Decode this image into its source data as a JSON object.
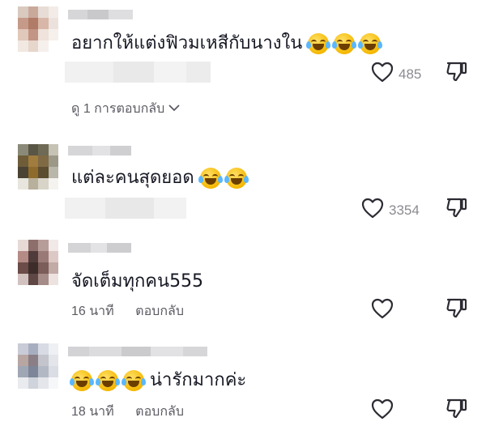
{
  "comments": [
    {
      "text": "อยากให้แต่งฟิวมเหสีกับนางใน",
      "emoji_count": 3,
      "like_count": "485",
      "view_replies": "ดู 1 การตอบกลับ"
    },
    {
      "text": "แต่ละคนสุดยอด",
      "emoji_count": 2,
      "like_count": "3354"
    },
    {
      "text": "จัดเต็มทุกคน555",
      "emoji_count": 0,
      "time": "16 นาที",
      "reply_label": "ตอบกลับ"
    },
    {
      "text": "น่ารักมากค่ะ",
      "emoji_count": 3,
      "emoji_first": true,
      "time": "18 นาที",
      "reply_label": "ตอบกลับ"
    }
  ],
  "icons": [
    "heart-outline-icon",
    "dislike-icon",
    "chevron-down-icon",
    "face-with-tears-of-joy-emoji"
  ],
  "colors": {
    "text": "#161823",
    "muted": "#5b5b63",
    "icon": "#2b2b33"
  }
}
